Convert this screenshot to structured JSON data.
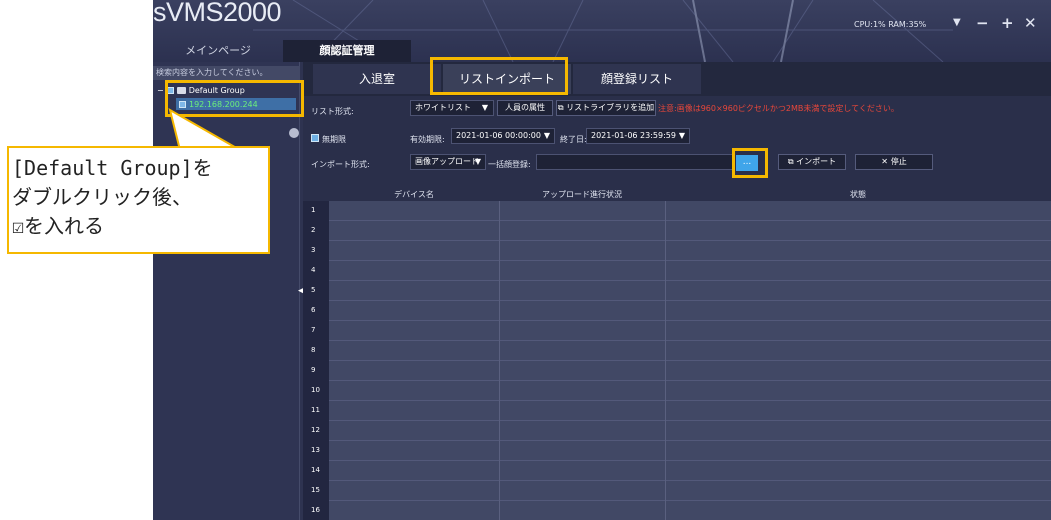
{
  "app": {
    "title": "sVMS2000",
    "stats": "CPU:1% RAM:35%",
    "controls": {
      "minimize": "−",
      "add": "+",
      "menu": "▼",
      "close": "✕"
    }
  },
  "top_tabs": {
    "main": "メインページ",
    "face": "顔認証管理"
  },
  "sidebar": {
    "search_placeholder": "検索内容を入力してください。",
    "group": "Default Group",
    "device": "192.168.200.244"
  },
  "sub_tabs": [
    "入退室",
    "リストインポート",
    "顔登録リスト"
  ],
  "controls": {
    "list_format_label": "リスト形式:",
    "list_format_value": "ホワイトリスト",
    "person_attr": "人員の属性",
    "add_library": "リストライブラリを追加",
    "notice": "注意:画像は960×960ピクセルかつ2MB未満で設定してください。",
    "unlimited_label": "無期限",
    "valid_label": "有効期限:",
    "valid_value": "2021-01-06 00:00:00",
    "end_label": "終了日:",
    "end_value": "2021-01-06 23:59:59",
    "import_format_label": "インポート形式:",
    "import_format_value": "画像アップロード",
    "bulk_label": "一括顔登録:",
    "browse": "...",
    "import": "インポート",
    "stop": "停止"
  },
  "table": {
    "headers": [
      "デバイス名",
      "アップロード進行状況",
      "状態"
    ],
    "rows": [
      "1",
      "2",
      "3",
      "4",
      "5",
      "6",
      "7",
      "8",
      "9",
      "10",
      "11",
      "12",
      "13",
      "14",
      "15",
      "16"
    ]
  },
  "annotation": {
    "line1": "[Default Group]を",
    "line2": "ダブルクリック後、",
    "line3": "☑を入れる"
  },
  "colors": {
    "highlight": "#f5b800",
    "notice": "#e8473a",
    "device_text": "#6cf07a",
    "browse_button": "#3fa5ea"
  }
}
